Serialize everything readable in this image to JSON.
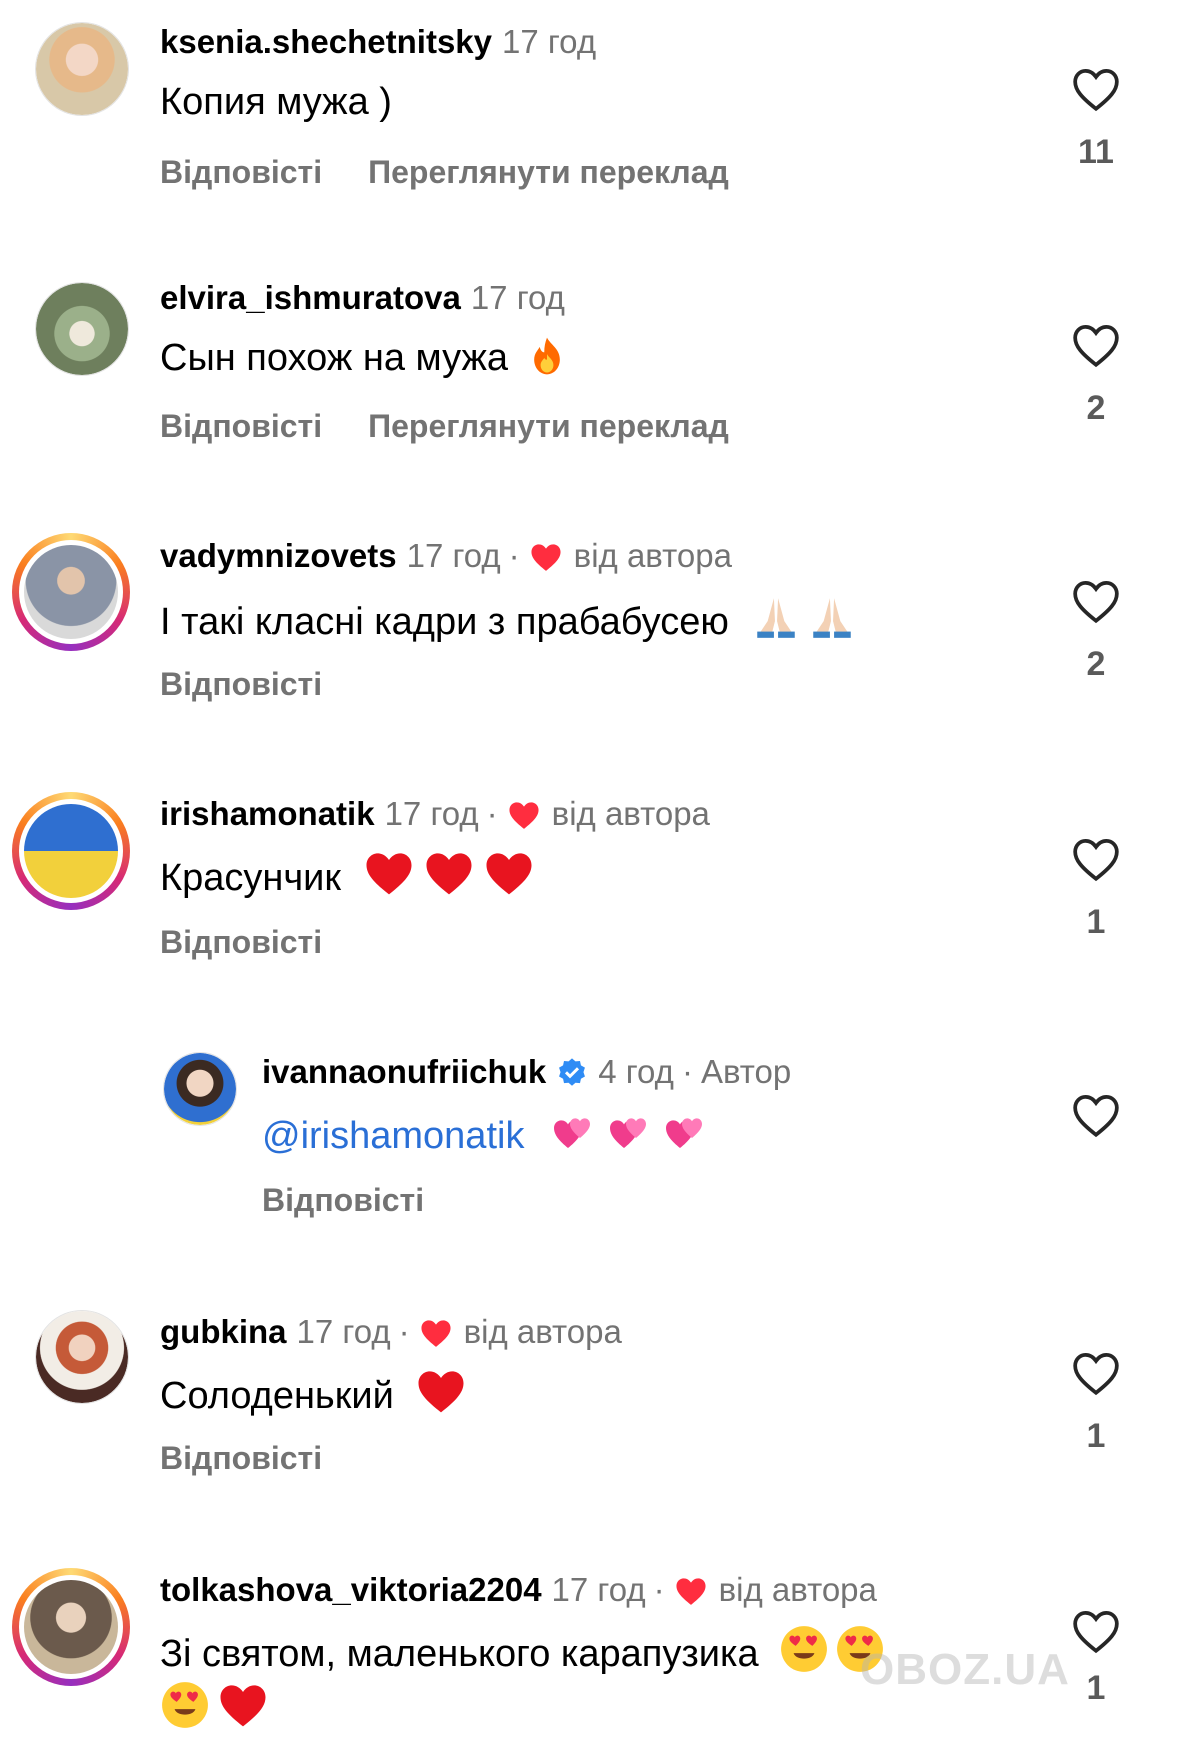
{
  "labels": {
    "reply": "Відповісті",
    "translate": "Переглянути переклад",
    "by_author": "від автора",
    "author_badge": "Автор"
  },
  "comments": [
    {
      "username": "ksenia.shechetnitsky",
      "time": "17 год",
      "text": "Копия мужа )",
      "likes": "11"
    },
    {
      "username": "elvira_ishmuratova",
      "time": "17 год",
      "text": "Сын похож на мужа",
      "likes": "2"
    },
    {
      "username": "vadymnizovets",
      "time": "17 год",
      "text": "І такі класні кадри з прабабусею",
      "likes": "2"
    },
    {
      "username": "irishamonatik",
      "time": "17 год",
      "text": "Красунчик",
      "likes": "1"
    },
    {
      "username": "ivannaonufriichuk",
      "time": "4 год",
      "mention": "@irishamonatik",
      "text": ""
    },
    {
      "username": "gubkina",
      "time": "17 год",
      "text": "Солоденький",
      "likes": "1"
    },
    {
      "username": "tolkashova_viktoria2204",
      "time": "17 год",
      "text": "Зі святом, маленького карапузика",
      "likes": "1"
    }
  ],
  "watermark": "OBOZ.UA",
  "colors": {
    "heart_red": "#ff2d3f",
    "mention_blue": "#2a6fd6",
    "meta_gray": "#737373",
    "verified_blue": "#2f8cf5"
  },
  "icons": [
    "heart-outline-icon",
    "heart-filled-icon",
    "verified-badge-icon",
    "fire-emoji",
    "pray-emoji",
    "red-heart-emoji",
    "two-hearts-emoji",
    "heart-eyes-emoji"
  ]
}
